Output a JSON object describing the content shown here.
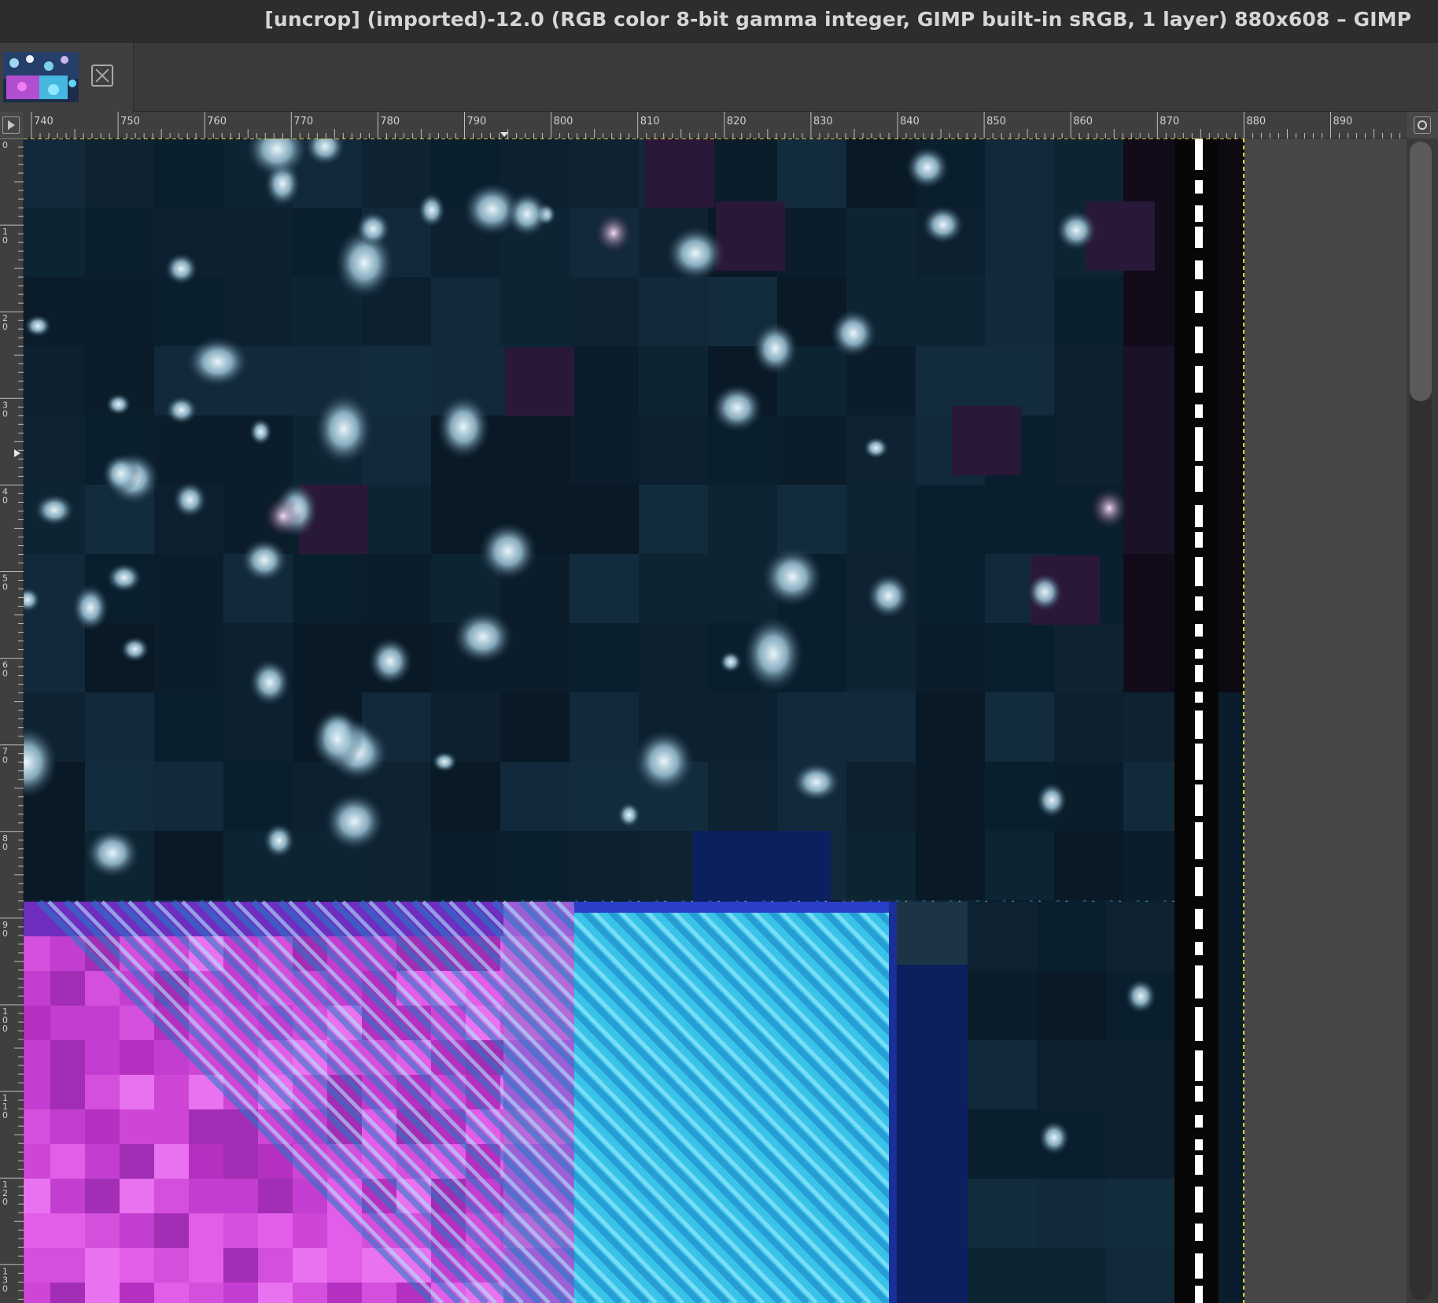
{
  "window": {
    "title": "[uncrop] (imported)-12.0 (RGB color 8-bit gamma integer, GIMP built-in sRGB, 1 layer) 880x608 – GIMP"
  },
  "tabs": [
    {
      "thumbnail": "image-thumbnail",
      "close_icon": "close-icon"
    }
  ],
  "rulers": {
    "horizontal_labels": [
      "740",
      "750",
      "760",
      "770",
      "780",
      "790",
      "800",
      "810",
      "820",
      "830",
      "840",
      "850",
      "860",
      "870",
      "880",
      "890"
    ],
    "vertical_labels": [
      "0",
      "10",
      "20",
      "30",
      "40",
      "50",
      "60",
      "70",
      "80",
      "90",
      "100",
      "110",
      "120",
      "130"
    ]
  },
  "icons": {
    "navigate": "navigate-icon",
    "zoom": "zoom-icon",
    "close": "close-icon"
  },
  "colors": {
    "dark_tile": "#0c2232",
    "magenta": "#d23fd2",
    "cyan": "#38c4e8",
    "navy": "#0c1f5e",
    "boundary": "#e8c832"
  }
}
